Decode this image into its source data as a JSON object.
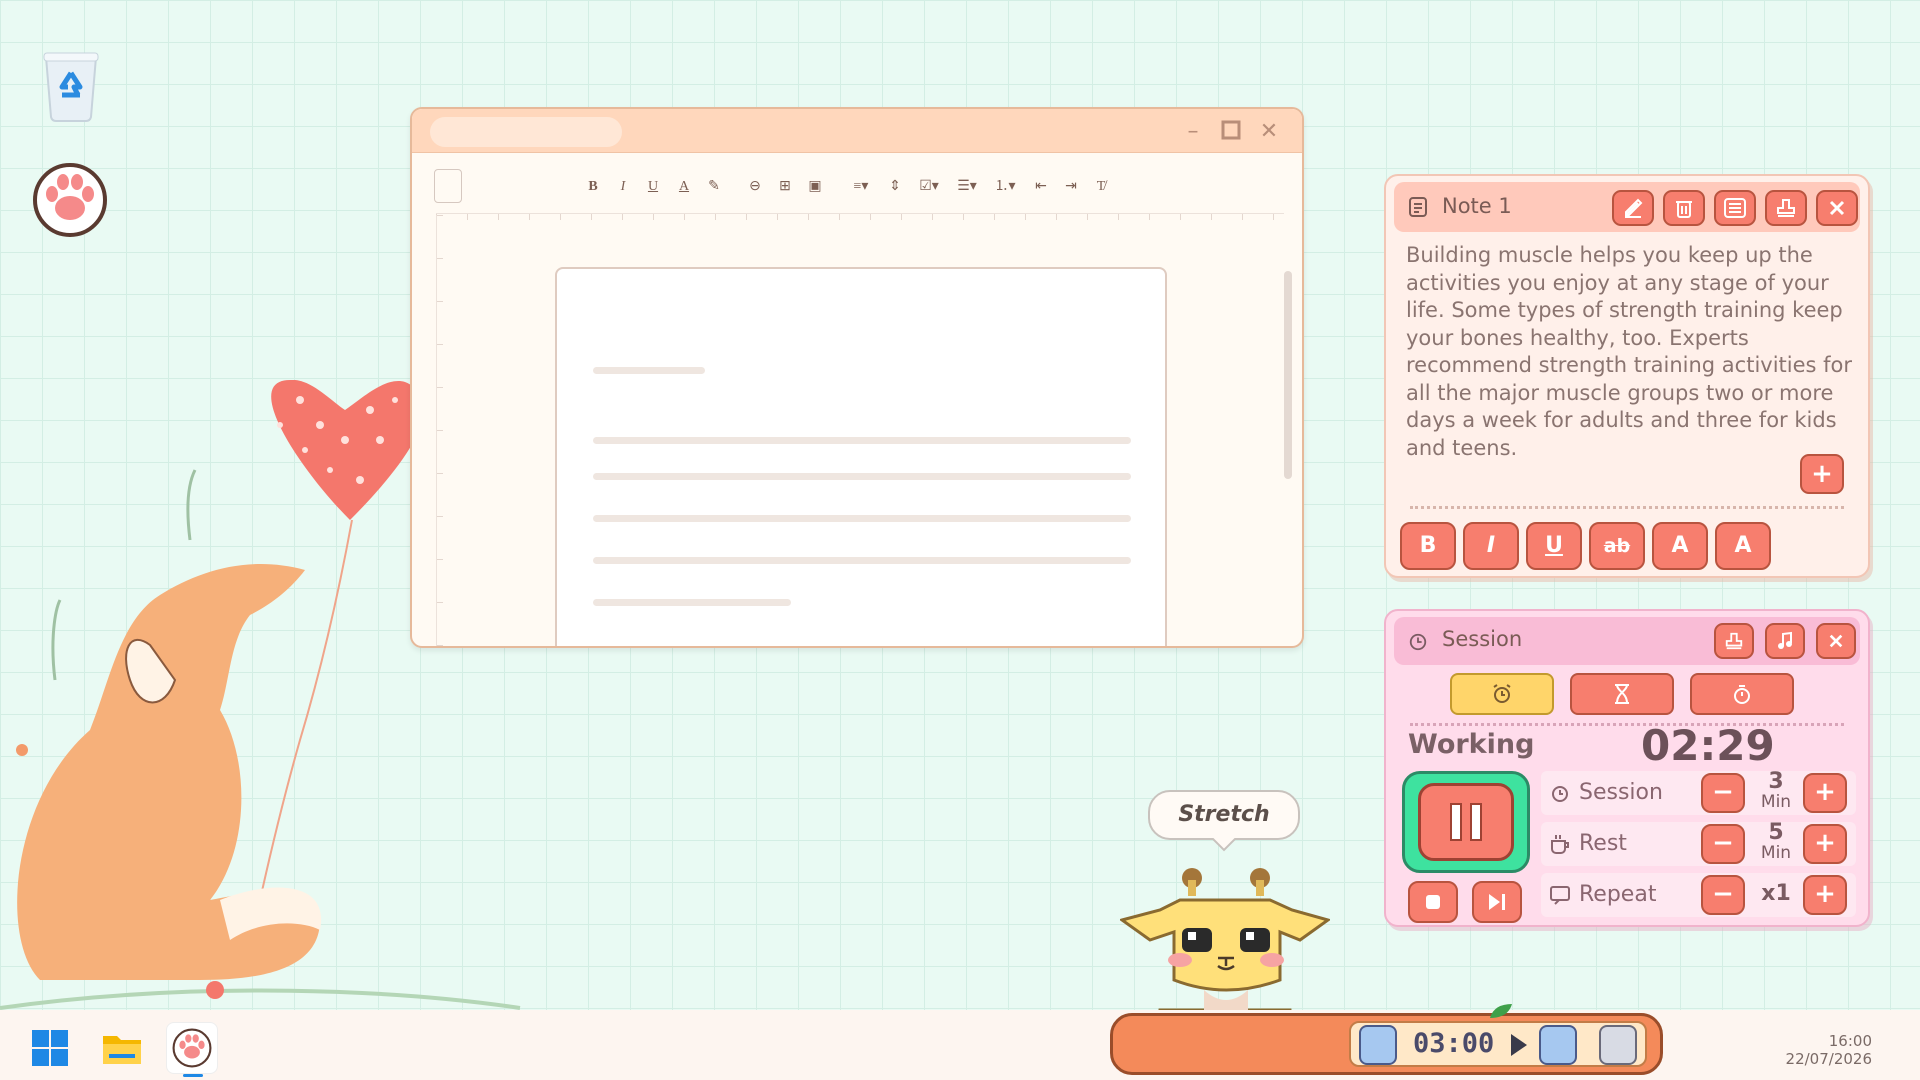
{
  "editor": {
    "toolbar": [
      "B",
      "I",
      "U",
      "A"
    ]
  },
  "note": {
    "title": "Note 1",
    "body": "Building muscle helps you keep up the activities you enjoy at any stage of your life. Some types of strength training keep your bones healthy, too. Experts recommend strength training activities for all the major muscle groups two or more days a week for adults and three for kids and teens.",
    "format_buttons": [
      "B",
      "I",
      "U",
      "ab",
      "A",
      "A"
    ],
    "add_label": "+"
  },
  "session": {
    "title": "Session",
    "status": "Working",
    "timer": "02:29",
    "rows": [
      {
        "label": "Session",
        "value": "3",
        "unit": "Min"
      },
      {
        "label": "Rest",
        "value": "5",
        "unit": "Min"
      },
      {
        "label": "Repeat",
        "value": "x1",
        "unit": ""
      }
    ],
    "minus": "−",
    "plus": "+"
  },
  "mascot": {
    "speech": "Stretch"
  },
  "widget_bar": {
    "time": "03:00"
  },
  "taskbar": {
    "time": "16:00",
    "date": "22/07/2026"
  },
  "colors": {
    "accent": "#f77e6e",
    "note_header": "#ffc9bb",
    "session_header": "#f9bcd6",
    "active_mode": "#ffd56a"
  }
}
